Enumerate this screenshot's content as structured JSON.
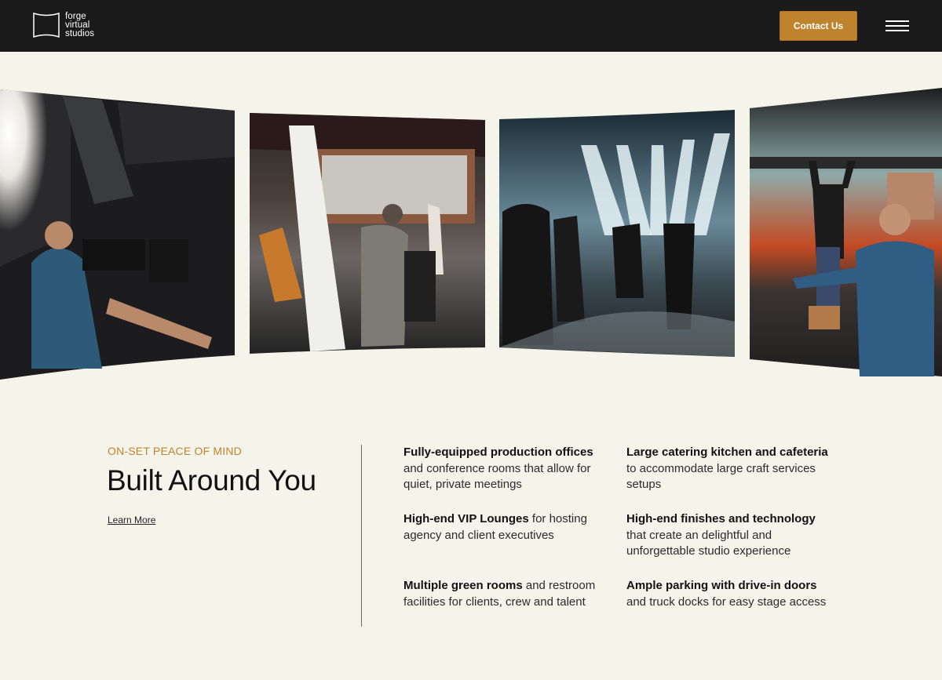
{
  "header": {
    "logo_lines": [
      "forge",
      "virtual",
      "studios"
    ],
    "contact_label": "Contact Us",
    "menu_icon": "hamburger-menu-icon"
  },
  "gallery": {
    "panels": [
      {
        "description": "Camera operator with rig at a studio"
      },
      {
        "description": "Film crew in a warehouse studio"
      },
      {
        "description": "Crew on a stage with bright lights"
      },
      {
        "description": "Performer on a set with a subway car"
      }
    ]
  },
  "section": {
    "eyebrow": "ON-SET PEACE OF MIND",
    "title": "Built Around You",
    "learn_more": "Learn More"
  },
  "features": [
    {
      "bold": "Fully-equipped production offices",
      "rest": " and conference rooms that allow for quiet, private meetings"
    },
    {
      "bold": "Large catering kitchen and cafeteria",
      "rest": " to accommodate large craft services setups"
    },
    {
      "bold": "High-end VIP Lounges",
      "rest": " for hosting agency and client executives"
    },
    {
      "bold": "High-end finishes and technology",
      "rest": " that create an delightful and unforgettable studio experience"
    },
    {
      "bold": "Multiple green rooms",
      "rest": " and restroom facilities for clients, crew and talent"
    },
    {
      "bold": "Ample parking with drive-in doors",
      "rest": " and truck docks for easy stage access"
    }
  ],
  "colors": {
    "background": "#f5f4ea",
    "header": "#1a1a1a",
    "accent": "#c0832d",
    "text": "#111111"
  }
}
